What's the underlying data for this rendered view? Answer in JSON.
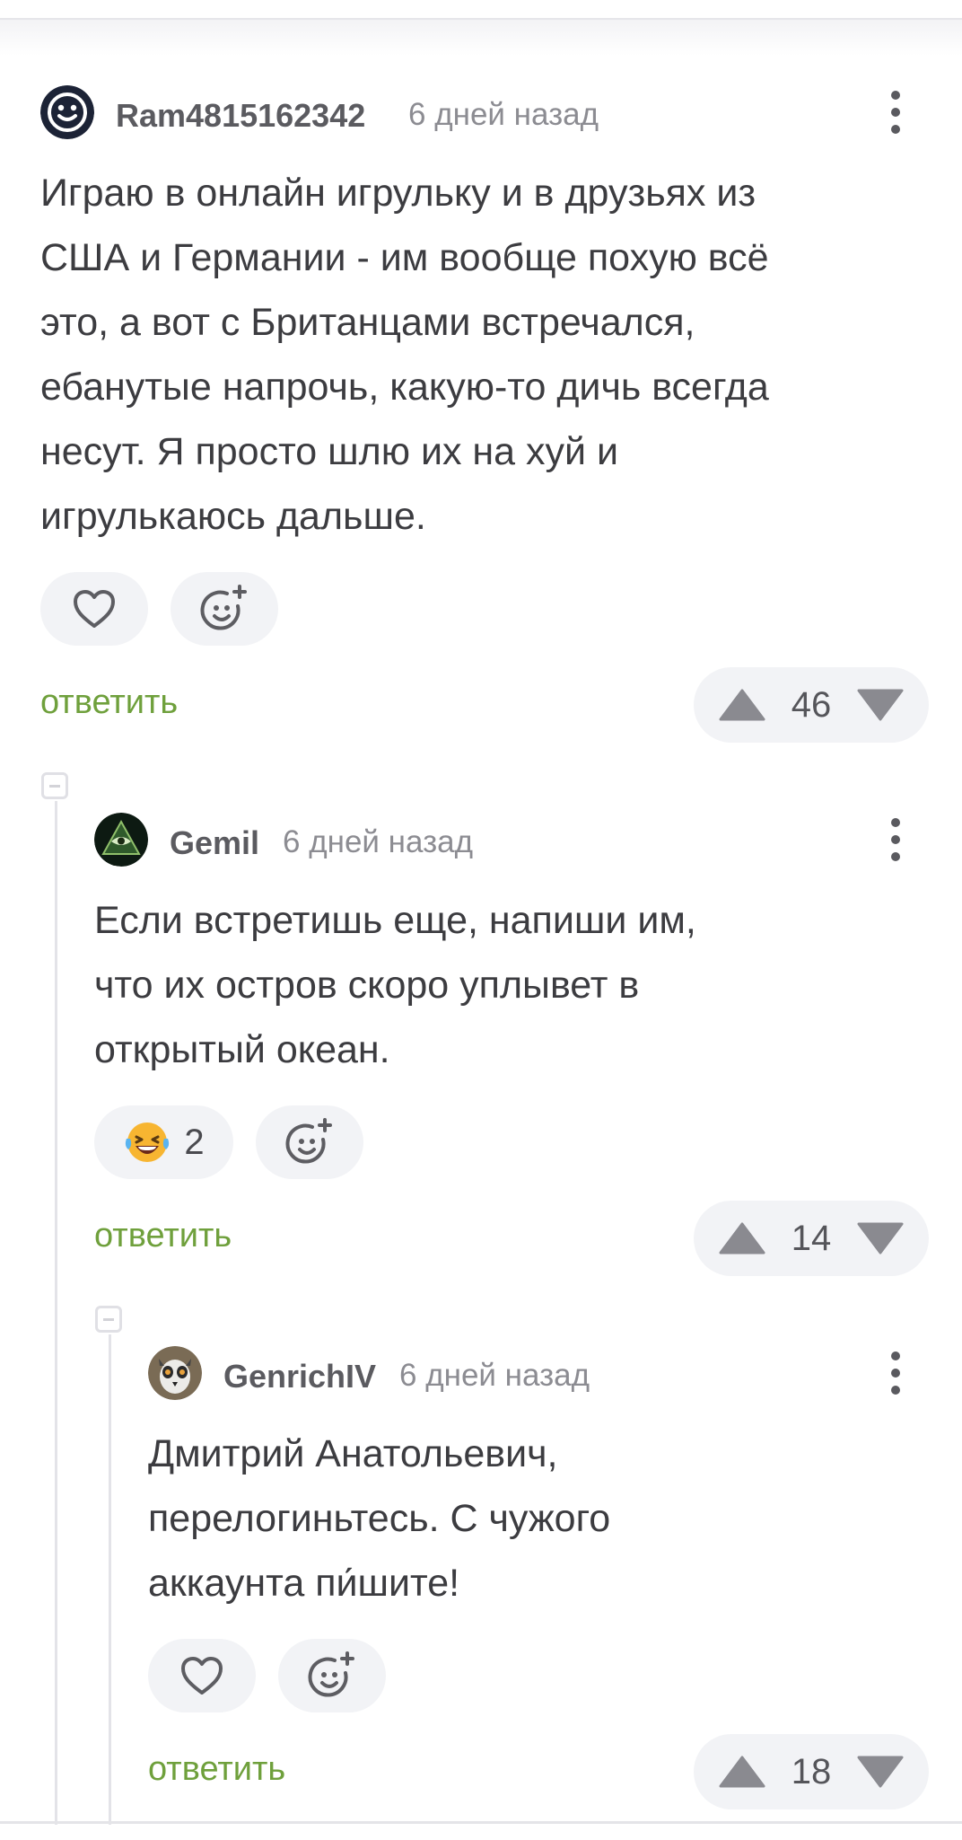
{
  "reply_label": "ответить",
  "comments": [
    {
      "author": "Ram4815162342",
      "time": "6 дней назад",
      "text": "Играю в онлайн игрульку и в друзьях из\nСША и Германии - им вообще похую всё\nэто, а вот с Британцами встречался,\nебанутые напрочь, какую-то дичь всегда\nнесут. Я просто шлю их на хуй и\nигрулькаюсь дальше.",
      "rating": "46",
      "avatar_icon": "smiley-avatar-icon"
    },
    {
      "author": "Gemil",
      "time": "6 дней назад",
      "text": "Если встретишь еще, напиши им,\nчто их остров скоро уплывет в\nоткрытый океан.",
      "reaction_count": "2",
      "reaction_icon": "laughing-tears-emoji-icon",
      "rating": "14",
      "avatar_icon": "all-seeing-eye-avatar-icon"
    },
    {
      "author": "GenrichIV",
      "time": "6 дней назад",
      "text": "Дмитрий Анатольевич,\nперелогиньтесь. С чужого\nаккаунта пи́шите!",
      "rating": "18",
      "avatar_icon": "lemur-avatar-icon"
    }
  ],
  "colors": {
    "reply_green": "#6fa03c",
    "pill_bg": "#f2f3f6",
    "icon_gray": "#5d5d62",
    "arrow_gray": "#8a8a90"
  }
}
